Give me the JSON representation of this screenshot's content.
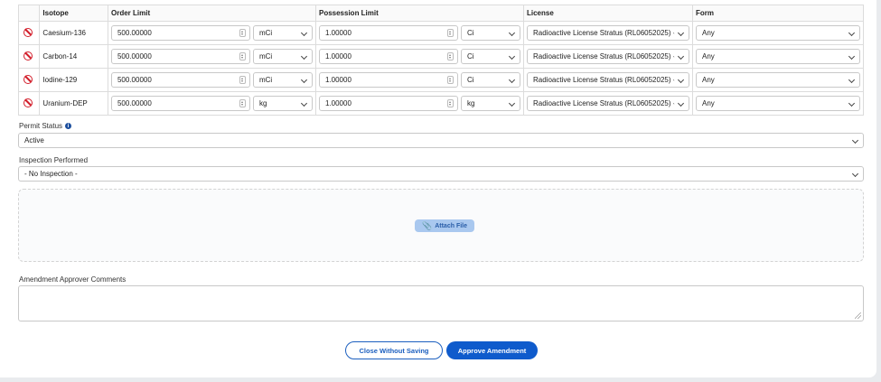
{
  "table": {
    "headers": [
      "Isotope",
      "Order Limit",
      "Possession Limit",
      "License",
      "Form"
    ],
    "rows": [
      {
        "isotope": "Caesium-136",
        "order_limit": "500.00000",
        "order_unit": "mCi",
        "possession_limit": "1.00000",
        "possession_unit": "Ci",
        "license": "Radioactive License Stratus (RL06052025) - ",
        "form": "Any"
      },
      {
        "isotope": "Carbon-14",
        "order_limit": "500.00000",
        "order_unit": "mCi",
        "possession_limit": "1.00000",
        "possession_unit": "Ci",
        "license": "Radioactive License Stratus (RL06052025) - ",
        "form": "Any"
      },
      {
        "isotope": "Iodine-129",
        "order_limit": "500.00000",
        "order_unit": "mCi",
        "possession_limit": "1.00000",
        "possession_unit": "Ci",
        "license": "Radioactive License Stratus (RL06052025) - ",
        "form": "Any"
      },
      {
        "isotope": "Uranium-DEP",
        "order_limit": "500.00000",
        "order_unit": "kg",
        "possession_limit": "1.00000",
        "possession_unit": "kg",
        "license": "Radioactive License Stratus (RL06052025) - ",
        "form": "Any"
      }
    ]
  },
  "permit_status": {
    "label": "Permit Status",
    "value": "Active"
  },
  "inspection": {
    "label": "Inspection Performed",
    "value": "- No Inspection -"
  },
  "attach": {
    "label": "Attach File"
  },
  "comments": {
    "label": "Amendment Approver Comments",
    "value": ""
  },
  "buttons": {
    "close": "Close Without Saving",
    "approve": "Approve Amendment"
  },
  "colors": {
    "primary": "#0f5bcc",
    "danger": "#d21d2a",
    "attach_bg": "#a9c8ef"
  }
}
